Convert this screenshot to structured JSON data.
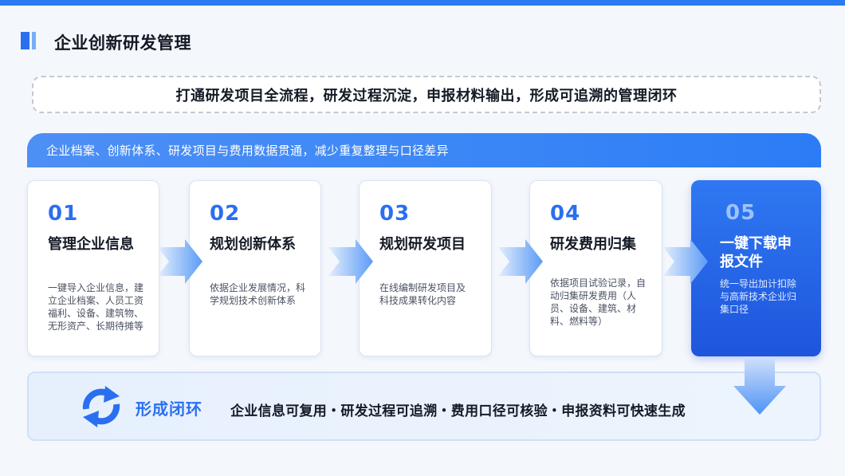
{
  "page": {
    "title": "企业创新研发管理",
    "slogan": "打通研发项目全流程，研发过程沉淀，申报材料输出，形成可追溯的管理闭环",
    "banner": "企业档案、创新体系、研发项目与费用数据贯通，减少重复整理与口径差异"
  },
  "steps": [
    {
      "num": "01",
      "title": "管理企业信息",
      "desc": "一键导入企业信息，建立企业档案、人员工资福利、设备、建筑物、无形资产、长期待摊等"
    },
    {
      "num": "02",
      "title": "规划创新体系",
      "desc": "依据企业发展情况，科学规划技术创新体系"
    },
    {
      "num": "03",
      "title": "规划研发项目",
      "desc": "在线编制研发项目及科技成果转化内容"
    },
    {
      "num": "04",
      "title": "研发费用归集",
      "desc": "依据项目试验记录，自动归集研发费用（人员、设备、建筑、材料、燃料等）"
    },
    {
      "num": "05",
      "title": "一键下载申报文件",
      "desc": "统一导出加计扣除与高新技术企业归集口径"
    }
  ],
  "loop": {
    "title": "形成闭环",
    "text": "企业信息可复用・研发过程可追溯・费用口径可核验・申报资料可快速生成"
  },
  "colors": {
    "accent": "#2a6ff0",
    "banner": "#3a86f6",
    "highlight_card": "#1e55dc"
  },
  "icons": {
    "title_mark": "double-bar-icon",
    "flow_arrow": "chevron-right-icon",
    "loop": "refresh-cycle-icon",
    "down": "chevron-down-icon"
  }
}
